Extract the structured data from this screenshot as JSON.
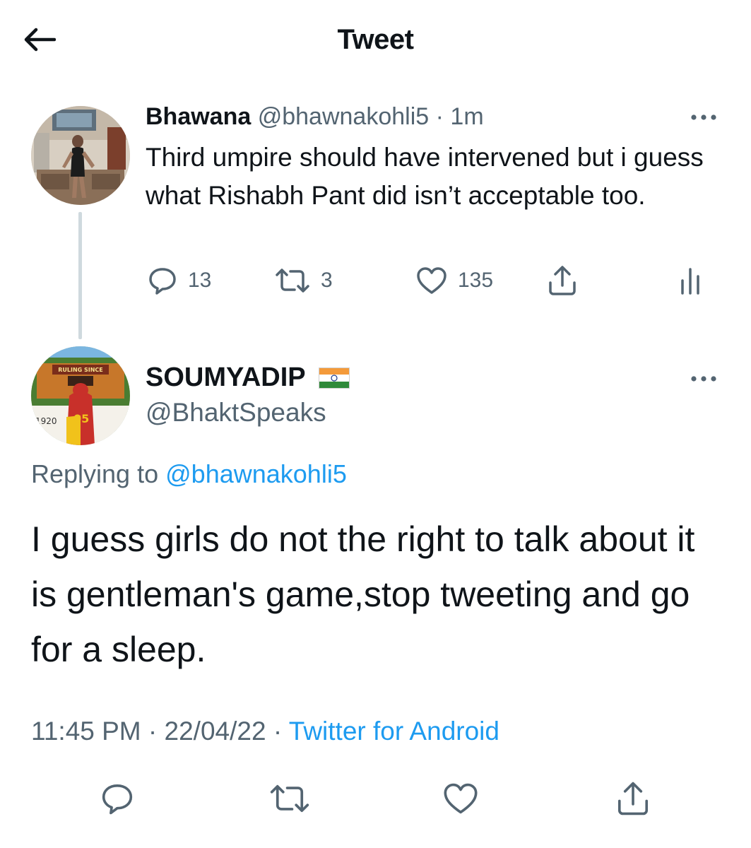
{
  "header": {
    "title": "Tweet",
    "back_icon": "arrow-left-icon"
  },
  "parent_tweet": {
    "name": "Bhawana",
    "handle": "@bhawnakohli5",
    "time": "1m",
    "separator": "·",
    "text": "Third umpire should have intervened but i guess what Rishabh Pant did isn’t acceptable too.",
    "replies": "13",
    "retweets": "3",
    "likes": "135"
  },
  "main_tweet": {
    "name": "SOUMYADIP",
    "flag": "india-flag",
    "handle": "@BhaktSpeaks",
    "replying_prefix": "Replying to",
    "replying_to": "@bhawnakohli5",
    "text": "I guess girls do not the right to talk about it is gentleman's game,stop tweeting and go for a sleep.",
    "time": "11:45 PM",
    "date": "22/04/22",
    "separator": "·",
    "source": "Twitter for Android"
  },
  "avatar_text": {
    "banner": "RULING SINCE",
    "year": "1920",
    "jersey_number": "05"
  },
  "colors": {
    "text": "#0f1419",
    "secondary": "#536471",
    "link": "#1d9bf0",
    "thread_line": "#cfd9de"
  }
}
